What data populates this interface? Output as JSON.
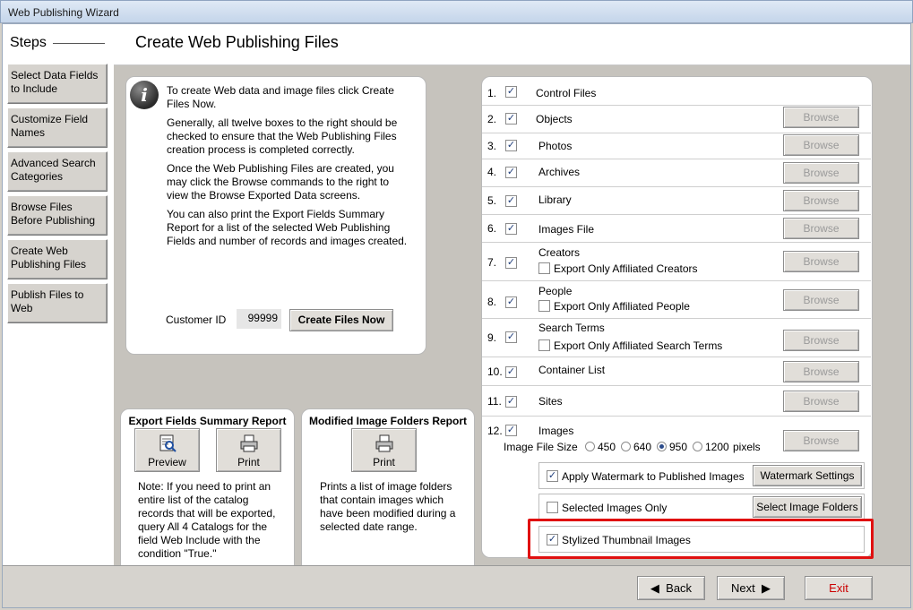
{
  "window_title": "Web Publishing Wizard",
  "steps": {
    "title": "Steps",
    "items": [
      "Select Data Fields to Include",
      "Customize Field Names",
      "Advanced Search Categories",
      "Browse Files Before Publishing",
      "Create Web Publishing Files",
      "Publish Files to Web"
    ]
  },
  "header": {
    "title": "Create Web Publishing Files"
  },
  "info": {
    "p1": "To create Web data and image files click Create Files Now.",
    "p2": "Generally, all twelve boxes to the right should be checked to ensure that the Web Publishing Files creation process is completed correctly.",
    "p3": "Once the Web Publishing Files are created, you may click the Browse commands to the right to view the Browse Exported Data screens.",
    "p4": "You can also print the Export Fields Summary Report for a list of the selected Web Publishing Fields and number of records and images created.",
    "customer_id_label": "Customer ID",
    "customer_id_value": "99999",
    "create_button": "Create Files Now"
  },
  "export_report": {
    "title": "Export Fields Summary Report",
    "preview_label": "Preview",
    "print_label": "Print",
    "note": "Note: If you need to print an entire list of the catalog records that will be exported, query All 4 Catalogs for the field Web Include with the condition \"True.\""
  },
  "modified_report": {
    "title": "Modified Image Folders Report",
    "print_label": "Print",
    "note": "Prints a list of image folders that contain images which have been modified during a selected date range."
  },
  "browse_label": "Browse",
  "checkmark": "✓",
  "files": [
    {
      "num": "1.",
      "label": "Control Files"
    },
    {
      "num": "2.",
      "label": "Objects"
    },
    {
      "num": "3.",
      "label": "Photos"
    },
    {
      "num": "4.",
      "label": "Archives"
    },
    {
      "num": "5.",
      "label": "Library"
    },
    {
      "num": "6.",
      "label": "Images File"
    },
    {
      "num": "7.",
      "label": "Creators",
      "sub": "Export Only Affiliated Creators"
    },
    {
      "num": "8.",
      "label": "People",
      "sub": "Export Only Affiliated People"
    },
    {
      "num": "9.",
      "label": "Search Terms",
      "sub": "Export Only Affiliated Search Terms"
    },
    {
      "num": "10.",
      "label": "Container List"
    },
    {
      "num": "11.",
      "label": "Sites"
    },
    {
      "num": "12.",
      "label": "Images"
    }
  ],
  "image_size": {
    "label": "Image File Size",
    "options": [
      "450",
      "640",
      "950",
      "1200"
    ],
    "selected": "950",
    "unit": "pixels"
  },
  "options": {
    "watermark_label": "Apply Watermark to Published Images",
    "watermark_checked": true,
    "watermark_button": "Watermark Settings",
    "selected_only_label": "Selected Images Only",
    "selected_only_checked": false,
    "select_folders_button": "Select Image Folders",
    "stylized_label": "Stylized Thumbnail Images",
    "stylized_checked": true
  },
  "footer": {
    "back": "Back",
    "next": "Next",
    "exit": "Exit"
  },
  "colors": {
    "highlight": "#e01010",
    "exit_text": "#cc0000"
  }
}
